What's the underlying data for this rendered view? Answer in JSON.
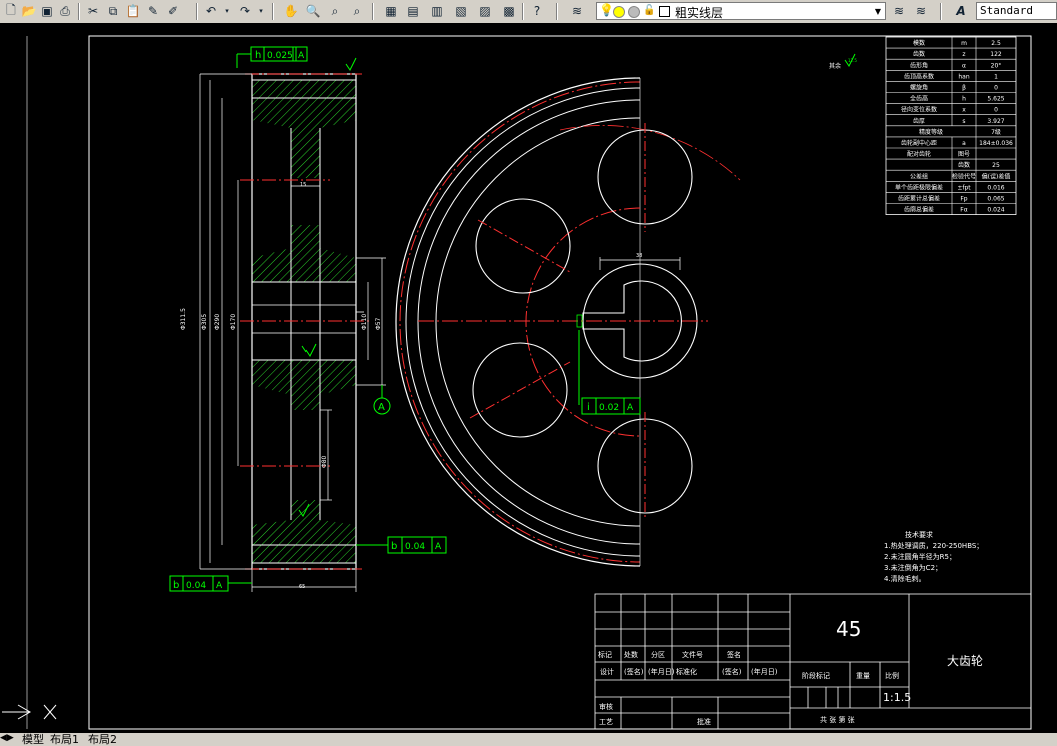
{
  "toolbar": {
    "layer_name": "粗实线层",
    "text_style": "Standard"
  },
  "drawing": {
    "params_table": [
      [
        "模数",
        "m",
        "2.5"
      ],
      [
        "齿数",
        "z",
        "122"
      ],
      [
        "齿形角",
        "α",
        "20°"
      ],
      [
        "齿顶高系数",
        "han",
        "1"
      ],
      [
        "螺旋角",
        "β",
        "0"
      ],
      [
        "全齿高",
        "h",
        "5.625"
      ],
      [
        "径向变位系数",
        "x",
        "0"
      ],
      [
        "齿厚",
        "s",
        "3.927"
      ],
      [
        "精度等级",
        "",
        "7级"
      ],
      [
        "齿轮副中心距",
        "a",
        "184±0.036"
      ],
      [
        "配对齿轮",
        "图号",
        ""
      ],
      [
        "",
        "齿数",
        "25"
      ],
      [
        "公差组",
        "检验代号",
        "偏(误)差值"
      ],
      [
        "单个齿距极限偏差",
        "±fpt",
        "0.016"
      ],
      [
        "齿距累计总偏差",
        "Fp",
        "0.065"
      ],
      [
        "齿廓总偏差",
        "Fα",
        "0.024"
      ]
    ],
    "tech_req_title": "技术要求",
    "tech_req_lines": [
      "1.热处理调质，220-250HBS；",
      "2.未注圆角半径为R5；",
      "3.未注倒角为C2；",
      "4.清除毛刺。"
    ],
    "tolerance_top": {
      "letter": "h",
      "value": "0.025",
      "datum": "A"
    },
    "tolerance_mid": {
      "letter": "i",
      "value": "0.02",
      "datum": "A"
    },
    "tolerance_right": {
      "letter": "b",
      "value": "0.04",
      "datum": "A"
    },
    "tolerance_left": {
      "letter": "b",
      "value": "0.04",
      "datum": "A"
    },
    "datum_circle": "A",
    "roughness_label": "其余",
    "roughness_value": "12.5",
    "dim_15": "15",
    "dim_65": "65",
    "dim_labels": [
      "Φ311.5",
      "Φ305",
      "Φ290",
      "Φ170",
      "Φ110",
      "Φ57",
      "Φ80",
      "Φ80"
    ],
    "keyway_dim": "38",
    "title_block": {
      "material": "45",
      "part_name": "大齿轮",
      "scale": "1:1.5",
      "row_labels": [
        "标记",
        "处数",
        "分区",
        "文件号",
        "签名"
      ],
      "design": "设计",
      "sign": "(签名)",
      "date": "(年月日)",
      "standard": "标准化",
      "stage": "阶段标记",
      "weight": "重量",
      "ratio": "比例",
      "review": "审核",
      "process": "工艺",
      "approve": "批准",
      "sheets": "共  张  第  张"
    }
  },
  "tabs": [
    "模型",
    "布局1",
    "布局2"
  ],
  "colors": {
    "outline": "#ffffff",
    "center": "#ff0000",
    "annot": "#00ff00",
    "hatch": "#2bd32b",
    "yellow": "#ffff00"
  }
}
